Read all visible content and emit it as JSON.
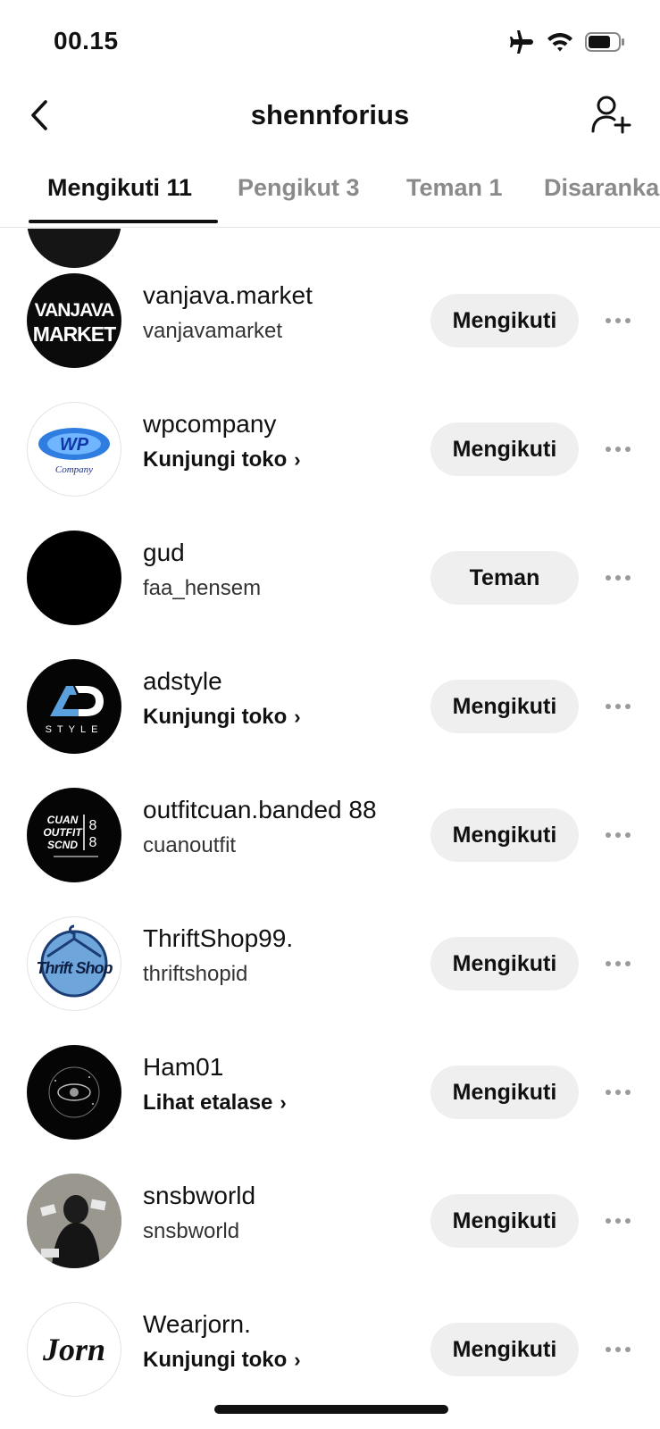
{
  "status_bar": {
    "time": "00.15",
    "icons": [
      "airplane-icon",
      "wifi-icon",
      "battery-icon"
    ]
  },
  "header": {
    "title": "shennforius",
    "back_icon": "chevron-left-icon",
    "add_icon": "add-user-icon"
  },
  "tabs": [
    {
      "label": "Mengikuti 11",
      "active": true
    },
    {
      "label": "Pengikut 3",
      "active": false
    },
    {
      "label": "Teman 1",
      "active": false
    },
    {
      "label": "Disaranka",
      "active": false
    }
  ],
  "list": [
    {
      "name": "vanjava.market",
      "sub": "vanjavamarket",
      "sub_is_link": false,
      "button": "Mengikuti",
      "avatar_text": [
        "VANJAVA",
        "MARKET"
      ]
    },
    {
      "name": "wpcompany",
      "sub": "Kunjungi toko",
      "sub_is_link": true,
      "button": "Mengikuti",
      "avatar_text": [
        "WP",
        "Company"
      ]
    },
    {
      "name": "gud",
      "sub": "faa_hensem",
      "sub_is_link": false,
      "button": "Teman",
      "avatar_text": []
    },
    {
      "name": "adstyle",
      "sub": "Kunjungi toko",
      "sub_is_link": true,
      "button": "Mengikuti",
      "avatar_text": [
        "AD",
        "STYLE"
      ]
    },
    {
      "name": "outfitcuan.banded 88",
      "sub": "cuanoutfit",
      "sub_is_link": false,
      "button": "Mengikuti",
      "avatar_text": [
        "CUAN",
        "OUTFIT",
        "SCND",
        "88"
      ]
    },
    {
      "name": "ThriftShop99.",
      "sub": "thriftshopid",
      "sub_is_link": false,
      "button": "Mengikuti",
      "avatar_text": [
        "Thrift Shop"
      ]
    },
    {
      "name": "Ham01",
      "sub": "Lihat etalase",
      "sub_is_link": true,
      "button": "Mengikuti",
      "avatar_text": []
    },
    {
      "name": "snsbworld",
      "sub": "snsbworld",
      "sub_is_link": false,
      "button": "Mengikuti",
      "avatar_text": []
    },
    {
      "name": "Wearjorn.",
      "sub": "Kunjungi toko",
      "sub_is_link": true,
      "button": "Mengikuti",
      "avatar_text": [
        "Jorn"
      ]
    }
  ],
  "chevron_glyph": "›",
  "more_icon": "more-horizontal-icon"
}
